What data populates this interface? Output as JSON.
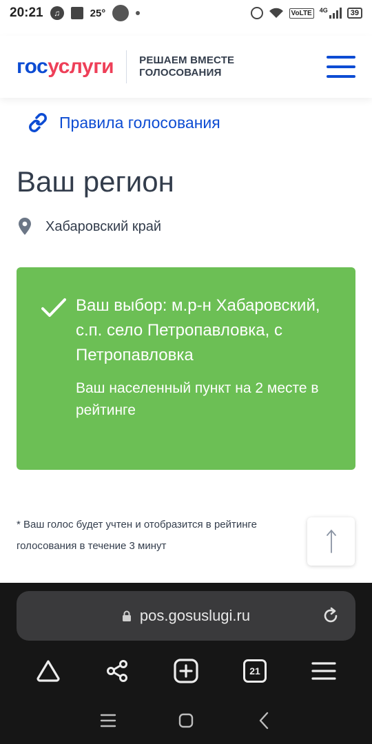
{
  "status_bar": {
    "time": "20:21",
    "temperature": "25°",
    "network": "4G",
    "volte": "VoLTE",
    "battery": "39"
  },
  "header": {
    "logo_part1": "гос",
    "logo_part2": "услуги",
    "tagline_line1": "РЕШАЕМ ВМЕСТЕ",
    "tagline_line2": "ГОЛОСОВАНИЯ",
    "brand_blue": "#0d4cd3",
    "brand_red": "#ee3f58"
  },
  "rules_link": {
    "label": "Правила голосования",
    "icon": "link-icon"
  },
  "region": {
    "title": "Ваш регион",
    "name": "Хабаровский край",
    "icon": "location-pin-icon"
  },
  "result_card": {
    "choice": "Ваш выбор: м.р-н Хабаровский, с.п. село Петропавловка, с Петропавловка",
    "rank": "Ваш населенный пункт на 2 месте в рейтинге",
    "color": "#6cbf55",
    "icon": "checkmark-icon"
  },
  "note": {
    "text": "* Ваш голос будет учтен и отобразится в рейтинге голосования в течение 3 минут"
  },
  "browser": {
    "url": "pos.gosuslugi.ru",
    "tabs_count": "21"
  }
}
